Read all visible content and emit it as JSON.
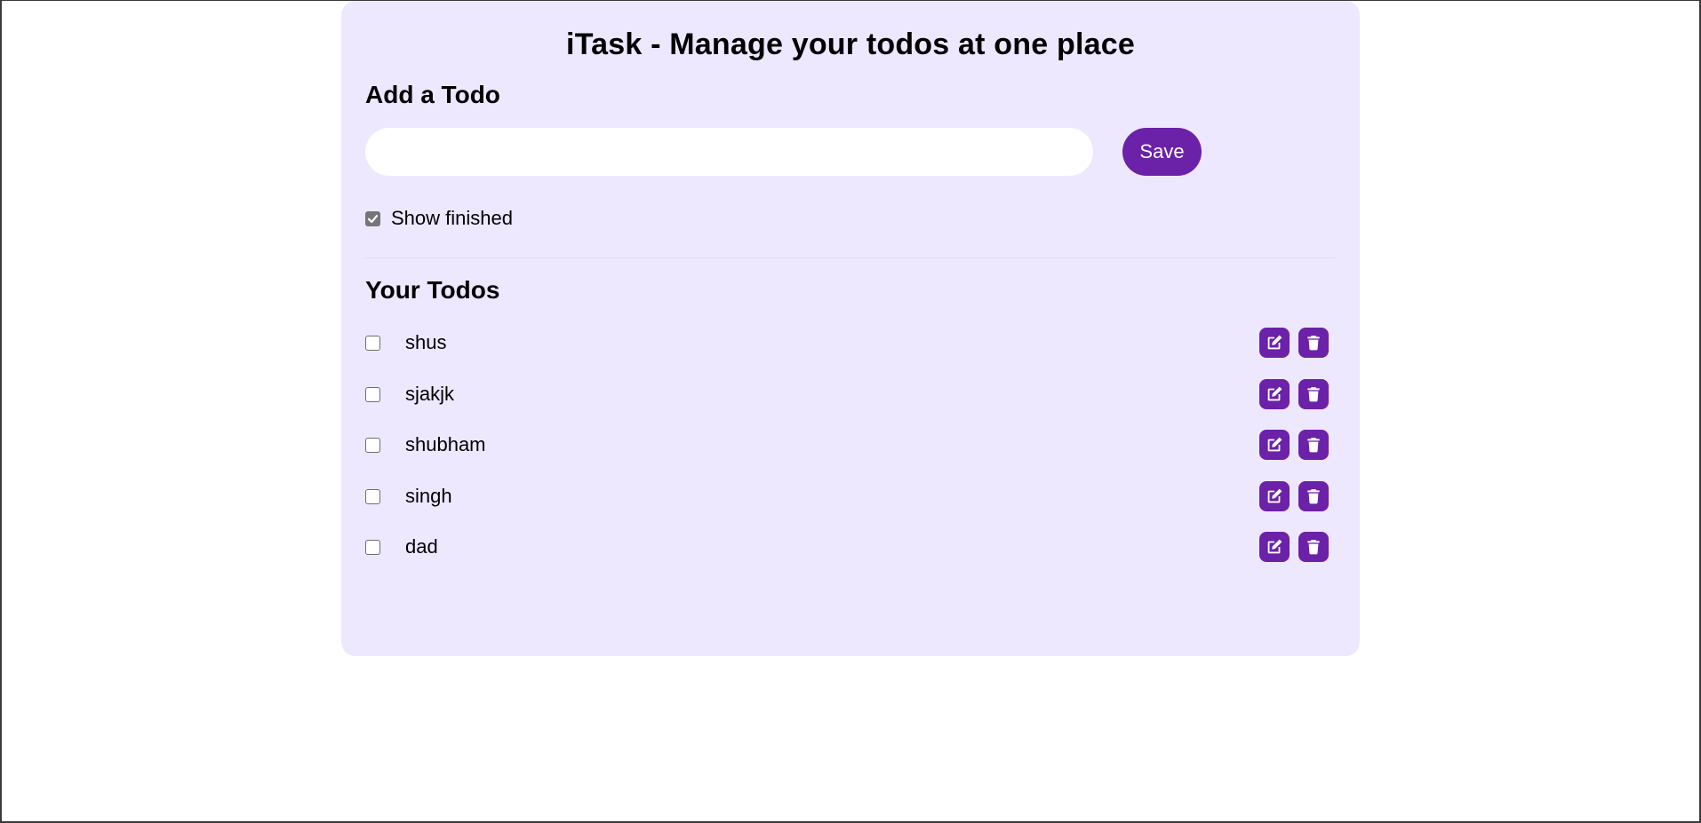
{
  "app": {
    "title": "iTask - Manage your todos at one place"
  },
  "add_todo": {
    "heading": "Add a Todo",
    "input_value": "",
    "input_placeholder": "",
    "save_label": "Save"
  },
  "filter": {
    "show_finished_label": "Show finished",
    "show_finished_checked": true
  },
  "todos_section": {
    "heading": "Your Todos",
    "items": [
      {
        "text": "shus",
        "done": false
      },
      {
        "text": "sjakjk",
        "done": false
      },
      {
        "text": "shubham",
        "done": false
      },
      {
        "text": "singh",
        "done": false
      },
      {
        "text": "dad",
        "done": false
      }
    ]
  },
  "icons": {
    "edit": "edit-icon",
    "delete": "trash-icon"
  },
  "colors": {
    "accent": "#6b21a8",
    "card_background": "#ede8fe"
  }
}
